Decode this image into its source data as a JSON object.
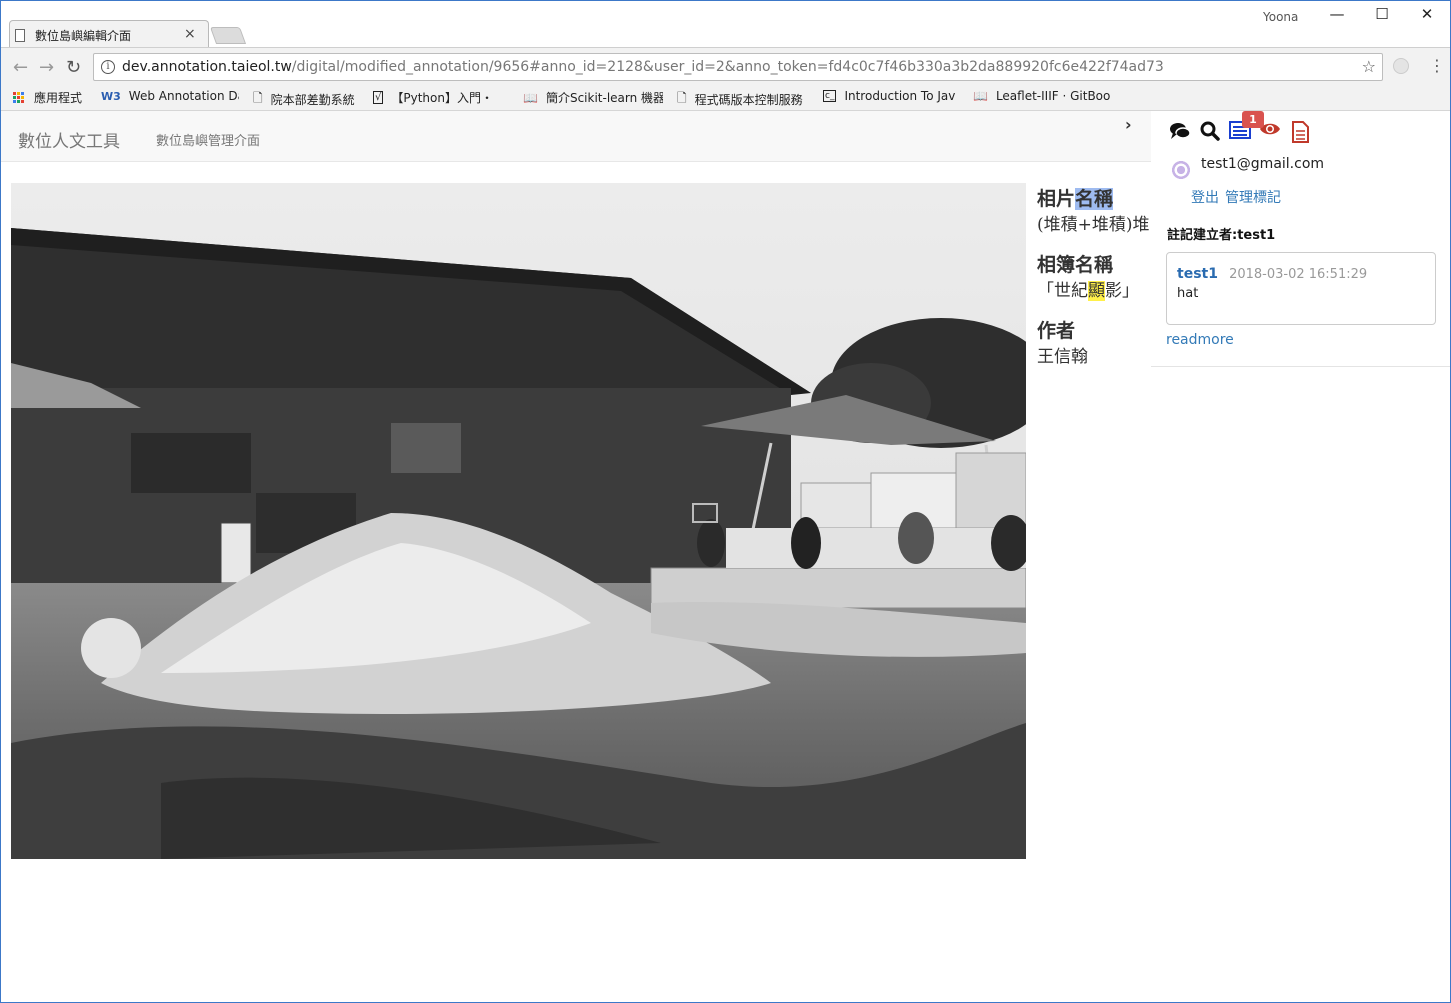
{
  "browser": {
    "tab_title": "數位島嶼編輯介面",
    "tab_close": "×",
    "profile_name": "Yoona",
    "window_controls": [
      "—",
      "☐",
      "✕"
    ],
    "url_host": "dev.annotation.taieol.tw",
    "url_path": "/digital/modified_annotation/9656#anno_id=2128&user_id=2&anno_token=fd4c0c7f46b330a3b2da889920fc6e422f74ad73",
    "bookmarks": [
      {
        "icon": "apps-icon",
        "label": "應用程式"
      },
      {
        "icon": "w3-icon",
        "label": "Web Annotation Da"
      },
      {
        "icon": "page-icon",
        "label": "院本部差勤系統"
      },
      {
        "icon": "mathtype-icon",
        "label": "【Python】入門・"
      },
      {
        "icon": "book-icon",
        "label": "簡介Scikit-learn 機器"
      },
      {
        "icon": "page-icon",
        "label": "程式碼版本控制服務"
      },
      {
        "icon": "codepen-icon",
        "label": "Introduction To Jav"
      },
      {
        "icon": "book-icon",
        "label": "Leaflet-IIIF · GitBoo"
      }
    ]
  },
  "navbar": {
    "brand": "數位人文工具",
    "link": "數位島嶼管理介面",
    "toggle": "›"
  },
  "metadata": {
    "photo_name_label_a": "相片",
    "photo_name_label_b": "名稱",
    "photo_name_value": "(堆積+堆積)堆",
    "album_label": "相簿名稱",
    "album_value_a": "「世紀",
    "album_value_b": "顯",
    "album_value_c": "影」",
    "author_label": "作者",
    "author_value": "王信翰"
  },
  "sidebar": {
    "icons": [
      "comments-icon",
      "search-icon",
      "list-icon",
      "eye-icon",
      "document-icon"
    ],
    "badge_count": "1",
    "user_email": "test1@gmail.com",
    "logout_label": "登出",
    "manage_label": "管理標記",
    "creator_label": "註記建立者:test1",
    "annotation": {
      "user": "test1",
      "timestamp": "2018-03-02 16:51:29",
      "body": "hat"
    },
    "readmore_label": "readmore"
  }
}
